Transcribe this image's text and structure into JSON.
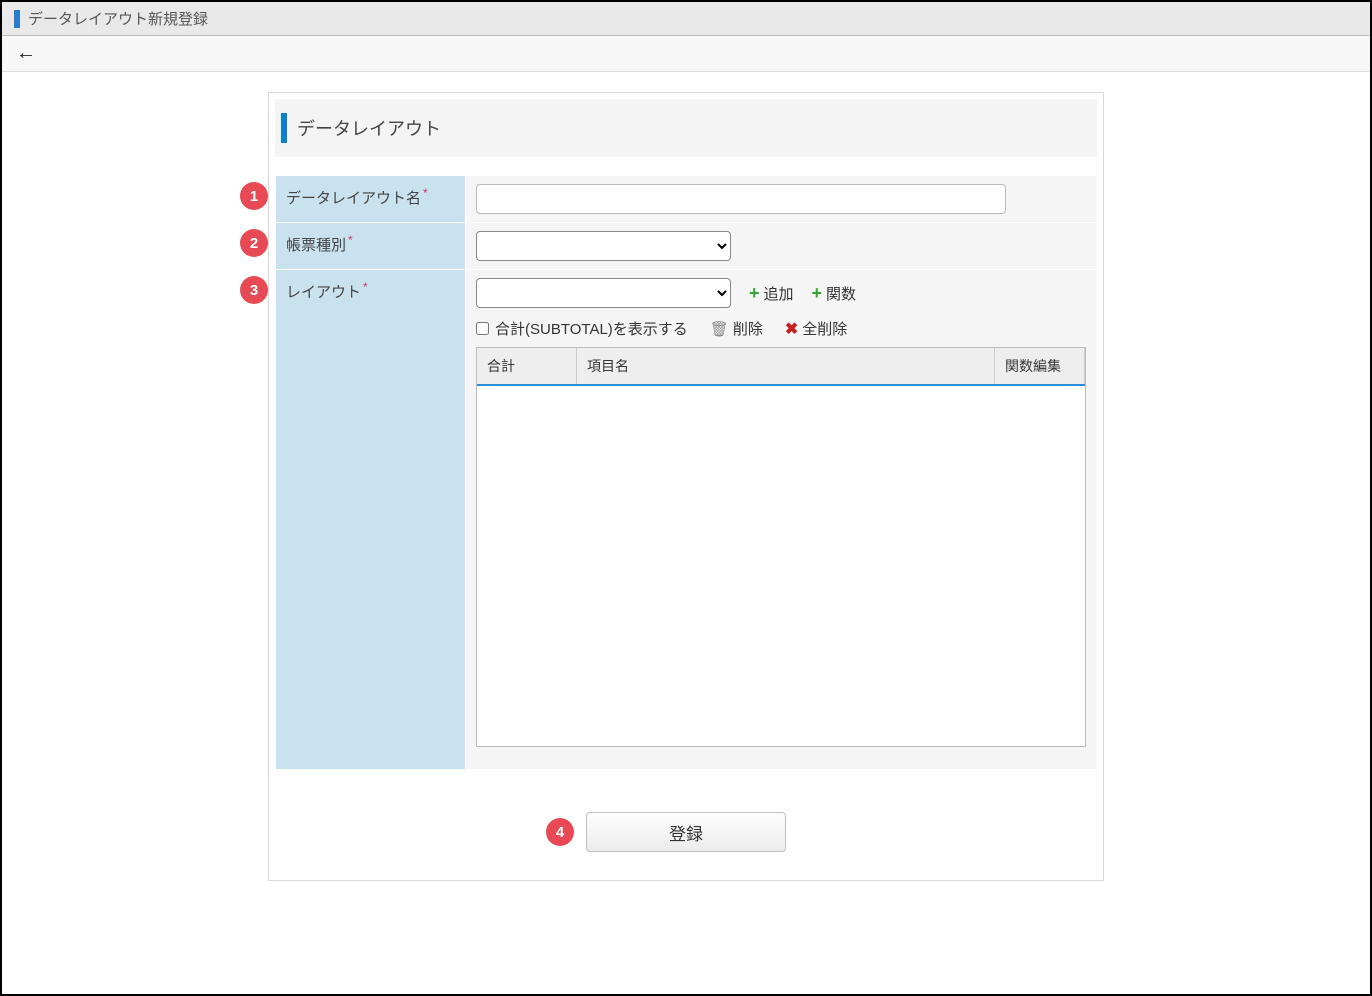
{
  "titlebar": {
    "title": "データレイアウト新規登録"
  },
  "section": {
    "title": "データレイアウト"
  },
  "form": {
    "name_label": "データレイアウト名",
    "name_value": "",
    "type_label": "帳票種別",
    "type_value": "",
    "layout_label": "レイアウト",
    "layout_value": "",
    "add_label": "追加",
    "function_label": "関数",
    "show_subtotal_label": "合計(SUBTOTAL)を表示する",
    "delete_label": "削除",
    "delete_all_label": "全削除"
  },
  "grid": {
    "col_total": "合計",
    "col_name": "項目名",
    "col_fn": "関数編集"
  },
  "footer": {
    "submit_label": "登録"
  },
  "callouts": {
    "c1": "1",
    "c2": "2",
    "c3": "3",
    "c4": "4"
  }
}
